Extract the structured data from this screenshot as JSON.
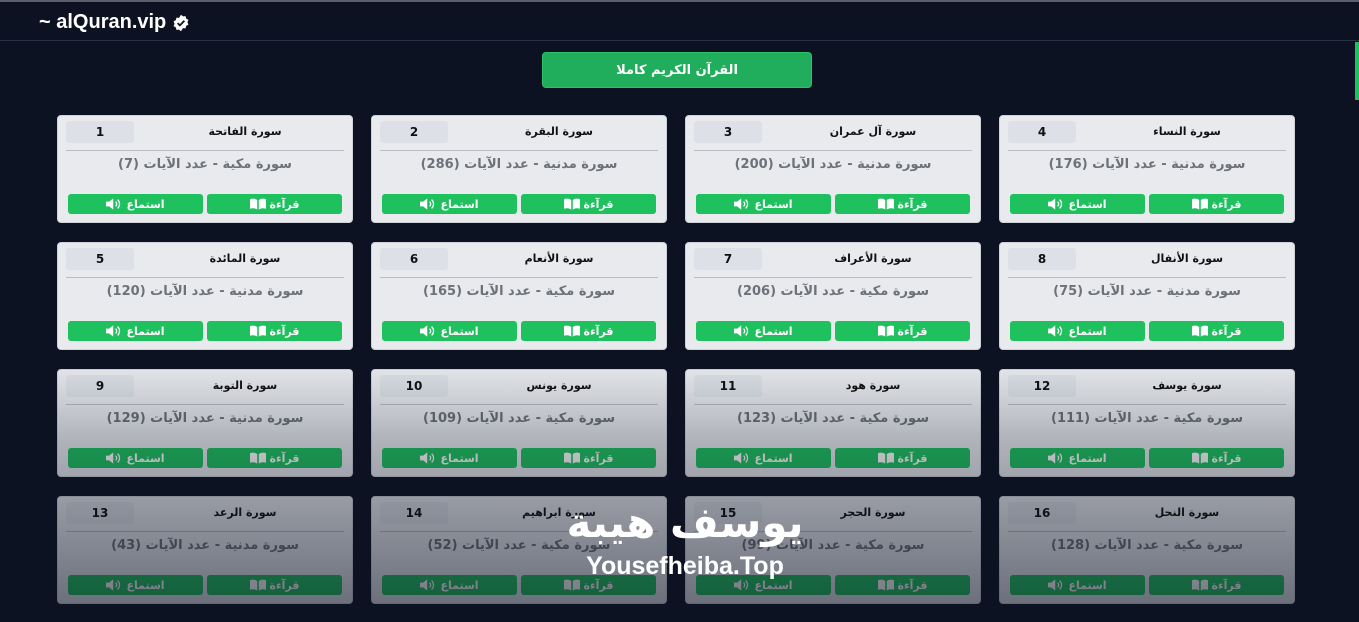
{
  "header": {
    "brand": "~ alQuran.vip"
  },
  "full_quran_button": "القرآن الكريم كاملا",
  "labels": {
    "read": "قرآءة",
    "listen": "استماع"
  },
  "colors": {
    "background": "#0d1223",
    "accent": "#1fc15f",
    "card": "#e8eaee"
  },
  "surahs": [
    {
      "number": "1",
      "name": "سورة الفاتحة",
      "info": "سورة مكية - عدد الآيات (7)"
    },
    {
      "number": "2",
      "name": "سورة البقرة",
      "info": "سورة مدنية - عدد الآيات (286)"
    },
    {
      "number": "3",
      "name": "سورة آل عمران",
      "info": "سورة مدنية - عدد الآيات (200)"
    },
    {
      "number": "4",
      "name": "سورة النساء",
      "info": "سورة مدنية - عدد الآيات (176)"
    },
    {
      "number": "5",
      "name": "سورة المائدة",
      "info": "سورة مدنية - عدد الآيات (120)"
    },
    {
      "number": "6",
      "name": "سورة الأنعام",
      "info": "سورة مكية - عدد الآيات (165)"
    },
    {
      "number": "7",
      "name": "سورة الأعراف",
      "info": "سورة مكية - عدد الآيات (206)"
    },
    {
      "number": "8",
      "name": "سورة الأنفال",
      "info": "سورة مدنية - عدد الآيات (75)"
    },
    {
      "number": "9",
      "name": "سورة التوبة",
      "info": "سورة مدنية - عدد الآيات (129)"
    },
    {
      "number": "10",
      "name": "سورة يونس",
      "info": "سورة مكية - عدد الآيات (109)"
    },
    {
      "number": "11",
      "name": "سورة هود",
      "info": "سورة مكية - عدد الآيات (123)"
    },
    {
      "number": "12",
      "name": "سورة يوسف",
      "info": "سورة مكية - عدد الآيات (111)"
    },
    {
      "number": "13",
      "name": "سورة الرعد",
      "info": "سورة مدنية - عدد الآيات (43)"
    },
    {
      "number": "14",
      "name": "سورة ابراهيم",
      "info": "سورة مكية - عدد الآيات (52)"
    },
    {
      "number": "15",
      "name": "سورة الحجر",
      "info": "سورة مكية - عدد الآيات (99)"
    },
    {
      "number": "16",
      "name": "سورة النحل",
      "info": "سورة مكية - عدد الآيات (128)"
    }
  ],
  "watermark": {
    "arabic": "يوسف هيبة",
    "latin": "Yousefheiba.Top"
  }
}
